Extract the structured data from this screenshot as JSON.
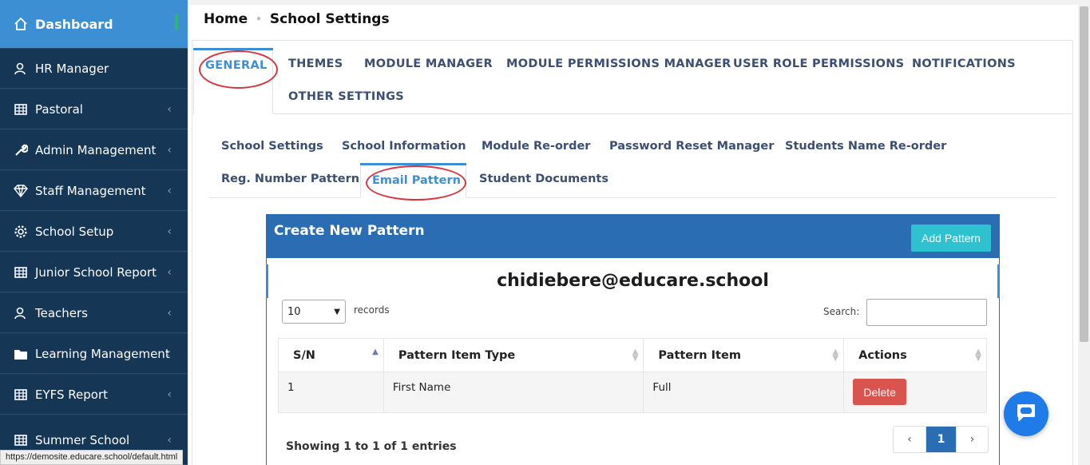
{
  "sidebar": {
    "items": [
      {
        "label": "Dashboard",
        "icon": "home-icon",
        "active": true
      },
      {
        "label": "HR Manager",
        "icon": "users-icon",
        "chevron": false
      },
      {
        "label": "Pastoral",
        "icon": "table-icon",
        "chevron": true
      },
      {
        "label": "Admin Management",
        "icon": "wrench-icon",
        "chevron": true
      },
      {
        "label": "Staff Management",
        "icon": "diamond-icon",
        "chevron": true
      },
      {
        "label": "School Setup",
        "icon": "gear-icon",
        "chevron": true
      },
      {
        "label": "Junior School Report",
        "icon": "table-icon",
        "chevron": true
      },
      {
        "label": "Teachers",
        "icon": "users-icon",
        "chevron": true
      },
      {
        "label": "Learning Management",
        "icon": "folder-icon",
        "chevron": true
      },
      {
        "label": "EYFS Report",
        "icon": "table-icon",
        "chevron": true
      },
      {
        "label": "Summer School",
        "icon": "table-icon",
        "chevron": true
      }
    ],
    "chevron_glyph": "‹"
  },
  "breadcrumb": {
    "home": "Home",
    "current": "School Settings"
  },
  "main_tabs": [
    "GENERAL",
    "THEMES",
    "MODULE MANAGER",
    "MODULE PERMISSIONS MANAGER",
    "USER ROLE PERMISSIONS",
    "NOTIFICATIONS",
    "OTHER SETTINGS"
  ],
  "sub_tabs": [
    "School Settings",
    "School Information",
    "Module Re-order",
    "Password Reset Manager",
    "Students Name Re-order",
    "Reg. Number Pattern",
    "Email Pattern",
    "Student Documents"
  ],
  "card": {
    "title": "Create New Pattern",
    "add_button": "Add Pattern",
    "email_preview": "chidiebere@educare.school",
    "page_length": "10",
    "records_label": "records",
    "search_label": "Search:",
    "search_value": ""
  },
  "table": {
    "headers": [
      "S/N",
      "Pattern Item Type",
      "Pattern Item",
      "Actions"
    ],
    "rows": [
      {
        "sn": "1",
        "type": "First Name",
        "item": "Full",
        "action": "Delete"
      }
    ]
  },
  "footer": {
    "showing": "Showing 1 to 1 of 1 entries",
    "prev": "‹",
    "current_page": "1",
    "next": "›"
  },
  "status_url": "https://demosite.educare.school/default.html",
  "colors": {
    "sidebar": "#163656",
    "active": "#3d8fd3",
    "card_header": "#2a6db3",
    "add_button": "#2ec1d0",
    "delete_button": "#d9534f",
    "annotation": "#d9343c"
  }
}
